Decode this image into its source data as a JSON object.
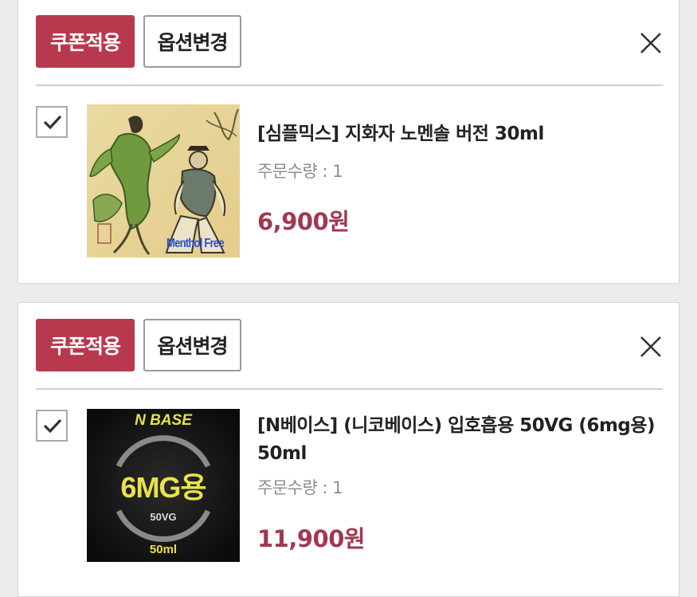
{
  "cart_items": [
    {
      "coupon_label": "쿠폰적용",
      "option_label": "옵션변경",
      "checked": true,
      "title": "[심플믹스] 지화자 노멘솔 버전 30ml",
      "quantity": "주문수량 : 1",
      "price": "6,900원",
      "thumb_text": "Menthol Free",
      "thumb_icon": "dancing-figures-painting"
    },
    {
      "coupon_label": "쿠폰적용",
      "option_label": "옵션변경",
      "checked": true,
      "title": "[N베이스] (니코베이스) 입호흡용 50VG (6mg용) 50ml",
      "quantity": "주문수량 : 1",
      "price": "11,900원",
      "thumb_brand": "N BASE",
      "thumb_strength": "6MG용",
      "thumb_vg": "50VG",
      "thumb_volume": "50ml"
    }
  ],
  "colors": {
    "accent": "#b8384d",
    "price": "#a2384f"
  }
}
